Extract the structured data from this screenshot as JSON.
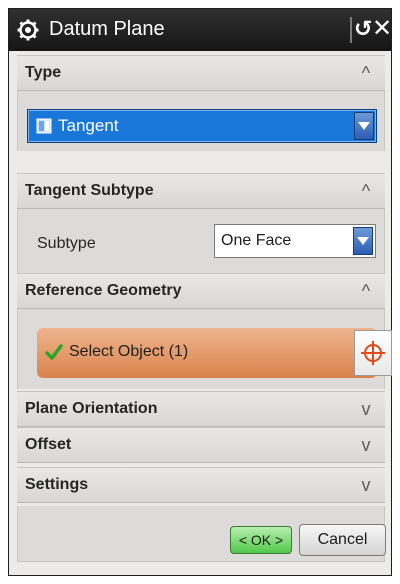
{
  "window": {
    "title": "Datum Plane",
    "title_icon": "gear-icon",
    "reset_icon": "reset-icon",
    "close_icon": "close-icon"
  },
  "sections": {
    "type": {
      "label": "Type",
      "state": "expanded",
      "dropdown_value": "Tangent",
      "dropdown_icon": "datum-plane-icon"
    },
    "tangent_subtype": {
      "label": "Tangent Subtype",
      "state": "expanded",
      "field_label": "Subtype",
      "field_value": "One Face"
    },
    "reference_geometry": {
      "label": "Reference Geometry",
      "state": "expanded",
      "selection_text": "Select Object (1)",
      "status_icon": "green-check-icon",
      "picker_icon": "crosshair-icon"
    },
    "plane_orientation": {
      "label": "Plane Orientation",
      "state": "collapsed"
    },
    "offset": {
      "label": "Offset",
      "state": "collapsed"
    },
    "settings": {
      "label": "Settings",
      "state": "collapsed"
    }
  },
  "footer": {
    "ok_label": "< OK >",
    "cancel_label": "Cancel"
  },
  "colors": {
    "accent_blue": "#1877d8",
    "select_orange": "#d9834c",
    "ok_green": "#52c84a",
    "titlebar": "#151515"
  },
  "icons": {
    "chevron_up": "^",
    "chevron_down": "v"
  }
}
